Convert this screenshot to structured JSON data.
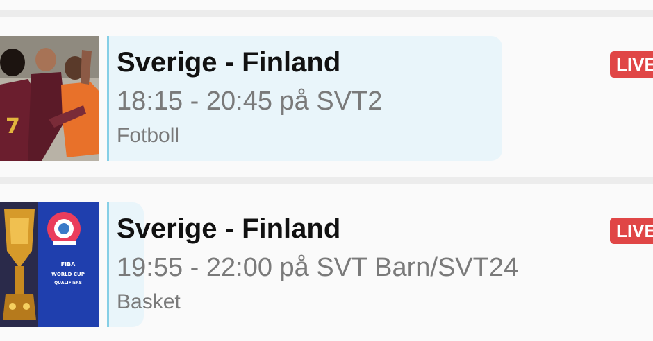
{
  "programs": [
    {
      "title": "Sverige - Finland",
      "time": "18:15 - 20:45 på SVT2",
      "category": "Fotboll",
      "badge": "LIVE",
      "progress": 0.42
    },
    {
      "title": "Sverige - Finland",
      "time": "19:55 - 22:00 på SVT Barn/SVT24",
      "category": "Basket",
      "badge": "LIVE",
      "progress": 0.06
    }
  ],
  "thumbnails": [
    {
      "kind": "football-players-photo",
      "jersey_number": "7"
    },
    {
      "kind": "basketball-world-cup-logo",
      "logo_text": "FIBA BASKETBALL WORLD CUP QUALIFIERS"
    }
  ],
  "colors": {
    "live_badge": "#e04646",
    "progress_line": "#86cfe6",
    "progress_fill": "#e9f5fa",
    "title_text": "#111111",
    "secondary_text": "#7a7a7a"
  }
}
